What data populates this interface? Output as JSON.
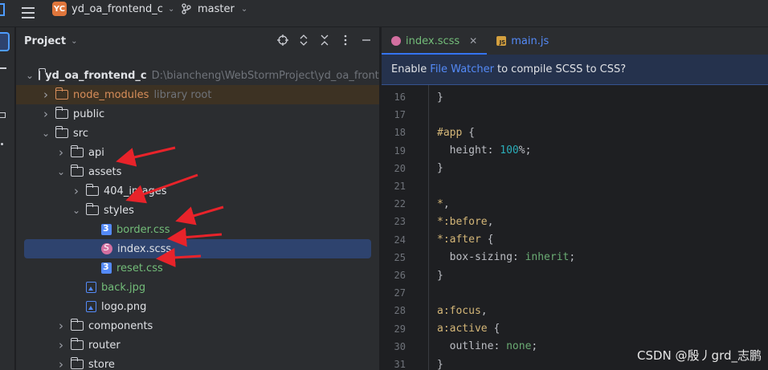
{
  "titlebar": {
    "project_badge": "YC",
    "project_name": "yd_oa_frontend_c",
    "branch": "master"
  },
  "project_panel": {
    "title": "Project",
    "tools": [
      "target-icon",
      "expand-collapse-icon",
      "close-all-icon",
      "more-icon",
      "minimize-icon"
    ]
  },
  "tree": [
    {
      "name": "yd_oa_frontend_c",
      "hint": "D:\\biancheng\\WebStormProject\\yd_oa_frontend_c",
      "type": "folder",
      "depth": 0,
      "expanded": true,
      "bold": true
    },
    {
      "name": "node_modules",
      "hint": "library root",
      "type": "folder-excluded",
      "depth": 1,
      "expanded": false
    },
    {
      "name": "public",
      "type": "folder",
      "depth": 1,
      "expanded": false
    },
    {
      "name": "src",
      "type": "folder",
      "depth": 1,
      "expanded": true
    },
    {
      "name": "api",
      "type": "folder",
      "depth": 2,
      "expanded": false
    },
    {
      "name": "assets",
      "type": "folder",
      "depth": 2,
      "expanded": true
    },
    {
      "name": "404_images",
      "type": "folder",
      "depth": 3,
      "expanded": false
    },
    {
      "name": "styles",
      "type": "folder",
      "depth": 3,
      "expanded": true
    },
    {
      "name": "border.css",
      "type": "css",
      "depth": 4,
      "color": "green"
    },
    {
      "name": "index.scss",
      "type": "scss",
      "depth": 4,
      "selected": true
    },
    {
      "name": "reset.css",
      "type": "css",
      "depth": 4,
      "color": "green"
    },
    {
      "name": "back.jpg",
      "type": "img",
      "depth": 3,
      "color": "green"
    },
    {
      "name": "logo.png",
      "type": "img",
      "depth": 3
    },
    {
      "name": "components",
      "type": "folder",
      "depth": 2,
      "expanded": false
    },
    {
      "name": "router",
      "type": "folder",
      "depth": 2,
      "expanded": false
    },
    {
      "name": "store",
      "type": "folder",
      "depth": 2,
      "expanded": false
    }
  ],
  "editor": {
    "tabs": [
      {
        "label": "index.scss",
        "icon": "scss-file-icon",
        "active": true,
        "closable": true
      },
      {
        "label": "main.js",
        "icon": "js-file-icon",
        "active": false,
        "closable": false
      }
    ],
    "notice": {
      "before": "Enable",
      "link": "File Watcher",
      "after": "to compile SCSS to CSS?"
    },
    "lines": [
      {
        "n": "16",
        "code": [
          {
            "t": "}",
            "c": ""
          }
        ]
      },
      {
        "n": "17",
        "code": []
      },
      {
        "n": "18",
        "code": [
          {
            "t": "#app",
            "c": "sel"
          },
          {
            "t": " {",
            "c": ""
          }
        ]
      },
      {
        "n": "19",
        "code": [
          {
            "t": "  height",
            "c": "prop"
          },
          {
            "t": ": ",
            "c": ""
          },
          {
            "t": "100",
            "c": "num"
          },
          {
            "t": "%;",
            "c": ""
          }
        ]
      },
      {
        "n": "20",
        "code": [
          {
            "t": "}",
            "c": ""
          }
        ]
      },
      {
        "n": "21",
        "code": []
      },
      {
        "n": "22",
        "code": [
          {
            "t": "*",
            "c": "sel"
          },
          {
            "t": ",",
            "c": ""
          }
        ]
      },
      {
        "n": "23",
        "code": [
          {
            "t": "*:before",
            "c": "sel"
          },
          {
            "t": ",",
            "c": ""
          }
        ]
      },
      {
        "n": "24",
        "code": [
          {
            "t": "*:after",
            "c": "sel"
          },
          {
            "t": " {",
            "c": ""
          }
        ]
      },
      {
        "n": "25",
        "code": [
          {
            "t": "  box-sizing",
            "c": "prop"
          },
          {
            "t": ": ",
            "c": ""
          },
          {
            "t": "inherit",
            "c": "kw"
          },
          {
            "t": ";",
            "c": ""
          }
        ]
      },
      {
        "n": "26",
        "code": [
          {
            "t": "}",
            "c": ""
          }
        ]
      },
      {
        "n": "27",
        "code": []
      },
      {
        "n": "28",
        "code": [
          {
            "t": "a:focus",
            "c": "sel"
          },
          {
            "t": ",",
            "c": ""
          }
        ]
      },
      {
        "n": "29",
        "code": [
          {
            "t": "a:active",
            "c": "sel"
          },
          {
            "t": " {",
            "c": ""
          }
        ]
      },
      {
        "n": "30",
        "code": [
          {
            "t": "  outline",
            "c": "prop"
          },
          {
            "t": ": ",
            "c": ""
          },
          {
            "t": "none",
            "c": "kw"
          },
          {
            "t": ";",
            "c": ""
          }
        ]
      },
      {
        "n": "31",
        "code": [
          {
            "t": "}",
            "c": ""
          }
        ]
      }
    ]
  },
  "watermark": "CSDN @殷丿grd_志鹏",
  "colors": {
    "accent": "#3574f0",
    "annotation_arrow": "#e8232a"
  }
}
